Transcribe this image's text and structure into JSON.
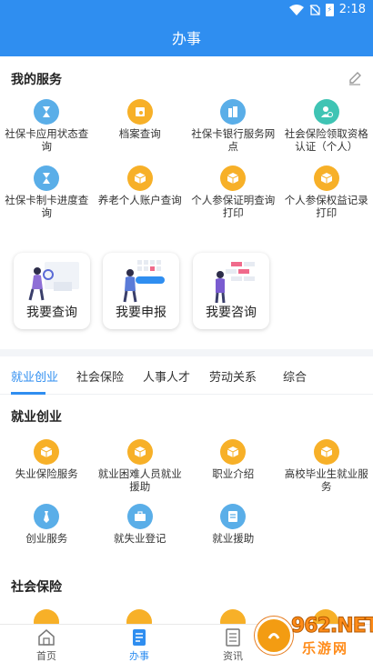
{
  "status_bar": {
    "time": "2:18",
    "battery_icon": "battery-charging-icon"
  },
  "header": {
    "title": "办事"
  },
  "my_services": {
    "title": "我的服务",
    "edit_icon": "pencil-icon",
    "items": [
      {
        "label": "社保卡应用状态查询",
        "icon": "hourglass-icon",
        "color": "#5aaee8"
      },
      {
        "label": "档案查询",
        "icon": "folder-icon",
        "color": "#f7b028"
      },
      {
        "label": "社保卡银行服务网点",
        "icon": "building-icon",
        "color": "#5aaee8"
      },
      {
        "label": "社会保险领取资格认证（个人）",
        "icon": "person-check-icon",
        "color": "#3fc4b4"
      },
      {
        "label": "社保卡制卡进度查询",
        "icon": "hourglass-icon",
        "color": "#5aaee8"
      },
      {
        "label": "养老个人账户查询",
        "icon": "cube-icon",
        "color": "#f7b028"
      },
      {
        "label": "个人参保证明查询打印",
        "icon": "cube-icon",
        "color": "#f7b028"
      },
      {
        "label": "个人参保权益记录打印",
        "icon": "cube-icon",
        "color": "#f7b028"
      }
    ]
  },
  "quick_cards": [
    {
      "label": "我要查询"
    },
    {
      "label": "我要申报"
    },
    {
      "label": "我要咨询"
    }
  ],
  "tabs": [
    {
      "label": "就业创业",
      "active": true
    },
    {
      "label": "社会保险",
      "active": false
    },
    {
      "label": "人事人才",
      "active": false
    },
    {
      "label": "劳动关系",
      "active": false
    },
    {
      "label": "综合",
      "active": false
    }
  ],
  "employment": {
    "title": "就业创业",
    "items": [
      {
        "label": "失业保险服务",
        "icon": "cube-icon",
        "color": "#f7b028"
      },
      {
        "label": "就业困难人员就业援助",
        "icon": "cube-icon",
        "color": "#f7b028"
      },
      {
        "label": "职业介绍",
        "icon": "cube-icon",
        "color": "#f7b028"
      },
      {
        "label": "高校毕业生就业服务",
        "icon": "cube-icon",
        "color": "#f7b028"
      },
      {
        "label": "创业服务",
        "icon": "tie-icon",
        "color": "#5aaee8"
      },
      {
        "label": "就失业登记",
        "icon": "briefcase-icon",
        "color": "#5aaee8"
      },
      {
        "label": "就业援助",
        "icon": "document-icon",
        "color": "#5aaee8"
      }
    ]
  },
  "social_insurance": {
    "title": "社会保险"
  },
  "bottom_nav": [
    {
      "label": "首页",
      "icon": "home-icon",
      "active": false
    },
    {
      "label": "办事",
      "icon": "service-icon",
      "active": true
    },
    {
      "label": "资讯",
      "icon": "news-icon",
      "active": false
    }
  ],
  "watermark": {
    "brand": "962.NET",
    "sub": "乐游网"
  }
}
